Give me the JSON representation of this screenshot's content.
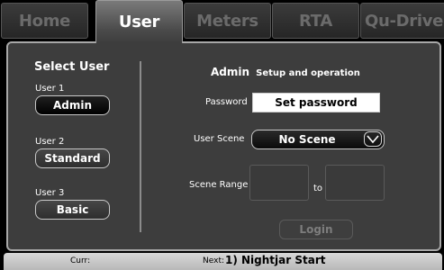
{
  "tabs": [
    {
      "label": "Home"
    },
    {
      "label": "User"
    },
    {
      "label": "Meters"
    },
    {
      "label": "RTA"
    },
    {
      "label": "Qu-Drive"
    }
  ],
  "active_tab": "User",
  "select_user": {
    "title": "Select User",
    "users": [
      {
        "slot": "User 1",
        "name": "Admin"
      },
      {
        "slot": "User 2",
        "name": "Standard"
      },
      {
        "slot": "User 3",
        "name": "Basic"
      }
    ]
  },
  "details": {
    "user_name": "Admin",
    "user_desc": "Setup and operation",
    "password_label": "Password",
    "password_value": "Set password",
    "scene_label": "User Scene",
    "scene_value": "No Scene",
    "range_label": "Scene Range",
    "range_to": "to",
    "login_label": "Login"
  },
  "status_bar": {
    "curr_label": "Curr:",
    "next_label": "Next:",
    "next_value": "1) Nightjar Start"
  }
}
